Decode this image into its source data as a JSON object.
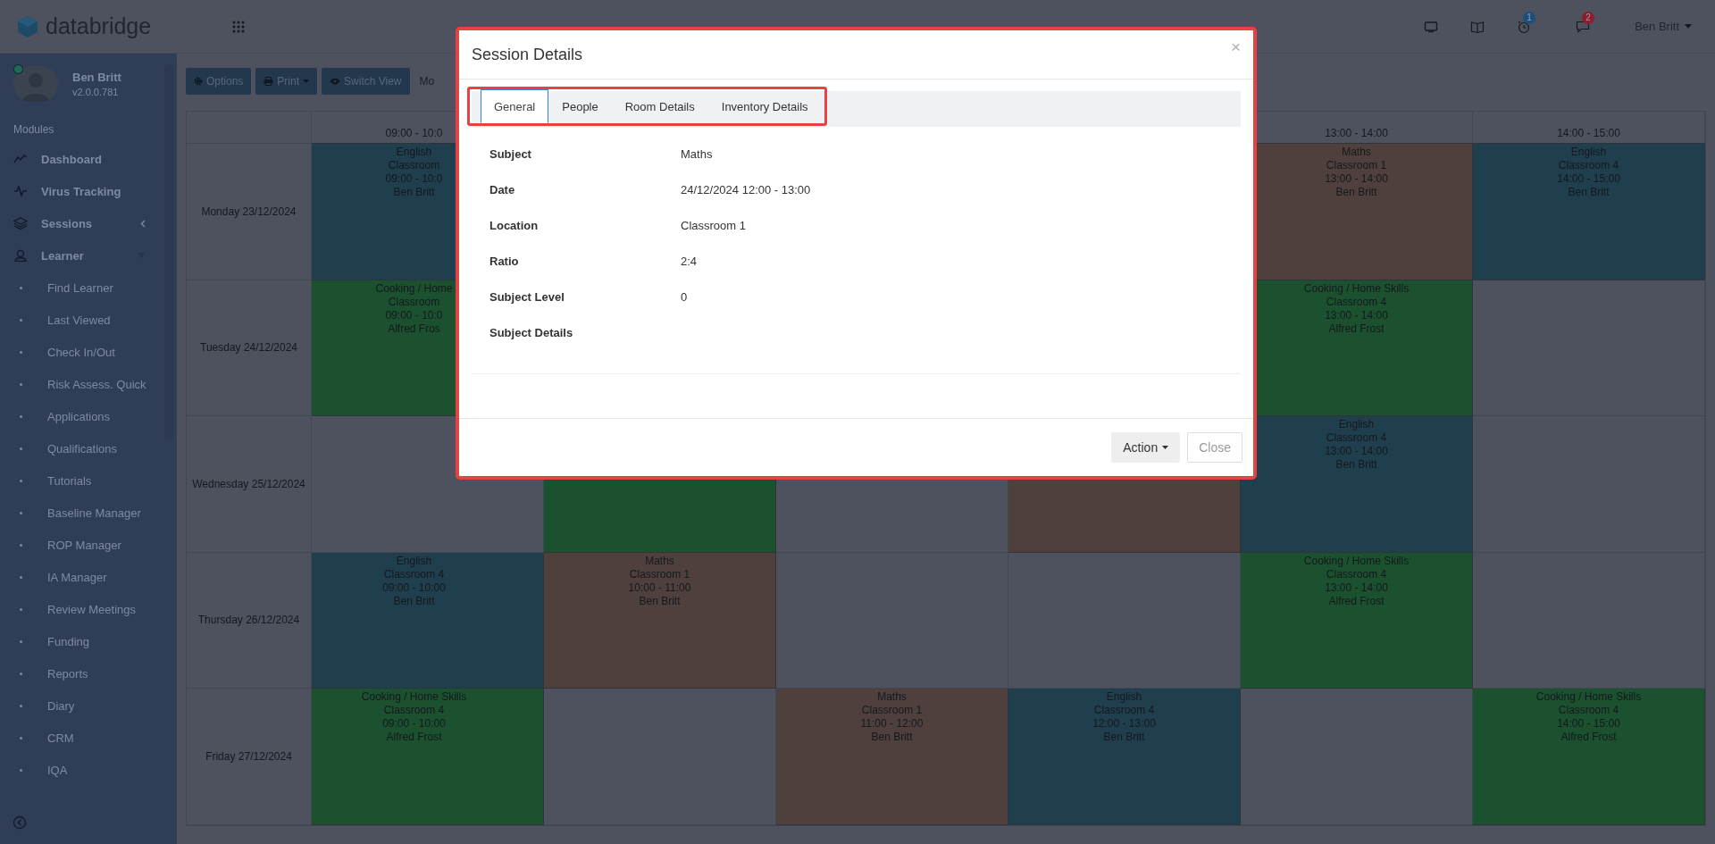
{
  "topbar": {
    "logo": "databridge",
    "user": "Ben Britt",
    "badges": [
      {
        "kind": "alarm",
        "count": "1",
        "color": "#1f4e79"
      },
      {
        "kind": "chat",
        "count": "2",
        "color": "#8b1e2c"
      }
    ]
  },
  "sidebar": {
    "user": {
      "name": "Ben Britt",
      "version": "v2.0.0.781",
      "online": true
    },
    "heading": "Modules",
    "items": [
      {
        "kind": "module",
        "label": "Dashboard"
      },
      {
        "kind": "module",
        "label": "Virus Tracking"
      },
      {
        "kind": "module",
        "label": "Sessions",
        "expanded": false
      },
      {
        "kind": "module",
        "label": "Learner",
        "expanded": true
      },
      {
        "kind": "sub",
        "label": "Find Learner"
      },
      {
        "kind": "sub",
        "label": "Last Viewed"
      },
      {
        "kind": "sub",
        "label": "Check In/Out"
      },
      {
        "kind": "sub",
        "label": "Risk Assess. Quick"
      },
      {
        "kind": "sub",
        "label": "Applications"
      },
      {
        "kind": "sub",
        "label": "Qualifications"
      },
      {
        "kind": "sub",
        "label": "Tutorials"
      },
      {
        "kind": "sub",
        "label": "Baseline Manager"
      },
      {
        "kind": "sub",
        "label": "ROP Manager"
      },
      {
        "kind": "sub",
        "label": "IA Manager"
      },
      {
        "kind": "sub",
        "label": "Review Meetings"
      },
      {
        "kind": "sub",
        "label": "Funding"
      },
      {
        "kind": "sub",
        "label": "Reports"
      },
      {
        "kind": "sub",
        "label": "Diary"
      },
      {
        "kind": "sub",
        "label": "CRM"
      },
      {
        "kind": "sub",
        "label": "IQA"
      }
    ]
  },
  "toolbar": [
    {
      "kind": "options",
      "label": "Options"
    },
    {
      "kind": "print",
      "label": "Print"
    },
    {
      "kind": "switch",
      "label": "Switch View"
    },
    {
      "kind": "plain",
      "label": "Mo"
    }
  ],
  "timetable": {
    "columns": [
      {
        "label": "09:00 - 10:0"
      },
      {},
      {},
      {},
      {
        "label": "13:00 - 14:00"
      },
      {
        "label": "14:00 - 15:00"
      }
    ],
    "rows": [
      {
        "day": "Monday 23/12/2024",
        "cells": [
          {
            "kind": "session",
            "color": "#1f3f4e",
            "lines": [
              "English",
              "Classroom",
              "09:00 - 10:0",
              "Ben Britt"
            ]
          },
          {
            "kind": "covered"
          },
          {
            "kind": "covered"
          },
          {
            "kind": "covered"
          },
          {
            "kind": "session",
            "color": "#4f403d",
            "lines": [
              "Maths",
              "Classroom 1",
              "13:00 - 14:00",
              "Ben Britt"
            ]
          },
          {
            "kind": "session",
            "color": "#1f3f4e",
            "lines": [
              "English",
              "Classroom 4",
              "14:00 - 15:00",
              "Ben Britt"
            ]
          }
        ]
      },
      {
        "day": "Tuesday 24/12/2024",
        "cells": [
          {
            "kind": "session",
            "color": "#1c5130",
            "lines": [
              "Cooking / Home",
              "Classroom",
              "09:00 - 10:0",
              "Alfred Fros"
            ]
          },
          {
            "kind": "covered"
          },
          {
            "kind": "covered"
          },
          {
            "kind": "covered"
          },
          {
            "kind": "session",
            "color": "#1c5130",
            "lines": [
              "Cooking / Home Skills",
              "Classroom 4",
              "13:00 - 14:00",
              "Alfred Frost"
            ]
          },
          {
            "kind": "empty"
          }
        ]
      },
      {
        "day": "Wednesday 25/12/2024",
        "cells": [
          {
            "kind": "empty"
          },
          {
            "kind": "session",
            "color": "#1c5130"
          },
          {
            "kind": "empty"
          },
          {
            "kind": "session",
            "color": "#4f403d"
          },
          {
            "kind": "session",
            "color": "#1f3f4e",
            "lines": [
              "English",
              "Classroom 4",
              "13:00 - 14:00",
              "Ben Britt"
            ]
          },
          {
            "kind": "empty"
          }
        ]
      },
      {
        "day": "Thursday 26/12/2024",
        "cells": [
          {
            "kind": "session",
            "color": "#1f3f4e",
            "lines": [
              "English",
              "Classroom 4",
              "09:00 - 10:00",
              "Ben Britt"
            ]
          },
          {
            "kind": "session",
            "color": "#4f403d",
            "lines": [
              "Maths",
              "Classroom 1",
              "10:00 - 11:00",
              "Ben Britt"
            ]
          },
          {
            "kind": "empty"
          },
          {
            "kind": "empty"
          },
          {
            "kind": "session",
            "color": "#1c5130",
            "lines": [
              "Cooking / Home Skills",
              "Classroom 4",
              "13:00 - 14:00",
              "Alfred Frost"
            ]
          },
          {
            "kind": "empty"
          }
        ]
      },
      {
        "day": "Friday 27/12/2024",
        "cells": [
          {
            "kind": "session",
            "color": "#1c5130",
            "lines": [
              "Cooking / Home Skills",
              "Classroom 4",
              "09:00 - 10:00",
              "Alfred Frost"
            ]
          },
          {
            "kind": "empty"
          },
          {
            "kind": "session",
            "color": "#4f403d",
            "lines": [
              "Maths",
              "Classroom 1",
              "11:00 - 12:00",
              "Ben Britt"
            ]
          },
          {
            "kind": "session",
            "color": "#1f3f4e",
            "lines": [
              "English",
              "Classroom 4",
              "12:00 - 13:00",
              "Ben Britt"
            ]
          },
          {
            "kind": "empty"
          },
          {
            "kind": "session",
            "color": "#1c5130",
            "lines": [
              "Cooking / Home Skills",
              "Classroom 4",
              "14:00 - 15:00",
              "Alfred Frost"
            ]
          }
        ]
      }
    ]
  },
  "modal": {
    "title": "Session Details",
    "close_glyph": "×",
    "tabs": [
      {
        "label": "General",
        "selected": true
      },
      {
        "label": "People",
        "selected": false
      },
      {
        "label": "Room Details",
        "selected": false
      },
      {
        "label": "Inventory Details",
        "selected": false
      }
    ],
    "fields": [
      {
        "label": "Subject",
        "value": "Maths"
      },
      {
        "label": "Date",
        "value": "24/12/2024 12:00 - 13:00"
      },
      {
        "label": "Location",
        "value": "Classroom 1"
      },
      {
        "label": "Ratio",
        "value": "2:4"
      },
      {
        "label": "Subject Level",
        "value": "0"
      },
      {
        "label": "Subject Details"
      }
    ],
    "buttons": [
      {
        "kind": "dropdown",
        "label": "Action"
      },
      {
        "kind": "close",
        "label": "Close"
      }
    ]
  }
}
